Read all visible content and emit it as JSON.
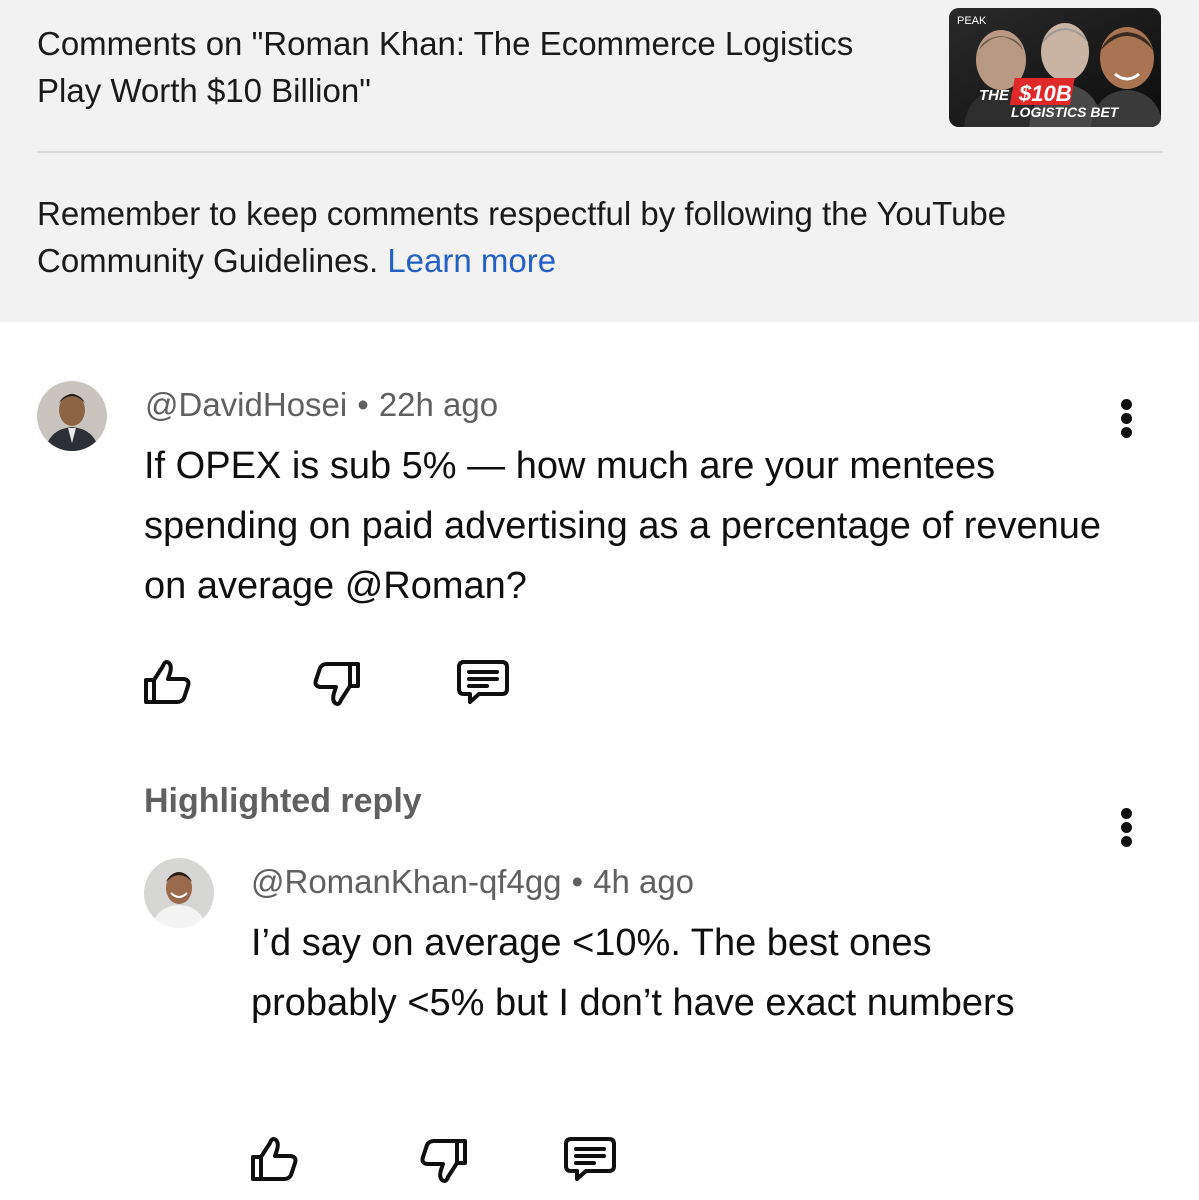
{
  "header": {
    "title": "Comments on \"Roman Khan: The Ecommerce Logistics Play Worth $10 Billion\"",
    "thumbnail": {
      "brand": "PEAK",
      "text_the": "THE",
      "text_amount": "$10B",
      "text_bet": "LOGISTICS BET"
    },
    "guidelines_text": "Remember to keep comments respectful by following the YouTube Community Guidelines.",
    "learn_more": "Learn more"
  },
  "comment": {
    "author": "@DavidHosei",
    "separator": "•",
    "time": "22h ago",
    "text": "If OPEX is sub 5% — how much are your mentees spending on paid advertising as a percentage of revenue on average @Roman?"
  },
  "highlighted_label": "Highlighted reply",
  "reply": {
    "author": "@RomanKhan-qf4gg",
    "separator": "•",
    "time": "4h ago",
    "text": "I’d say on average <10%. The best ones probably <5% but I don’t have exact numbers"
  },
  "icons": {
    "like": "thumbs-up-icon",
    "dislike": "thumbs-down-icon",
    "reply": "comment-icon",
    "menu": "more-vertical-icon"
  },
  "colors": {
    "header_bg": "#f2f2f2",
    "link": "#2360c6",
    "meta": "#606060",
    "thumb_red": "#e02828"
  }
}
